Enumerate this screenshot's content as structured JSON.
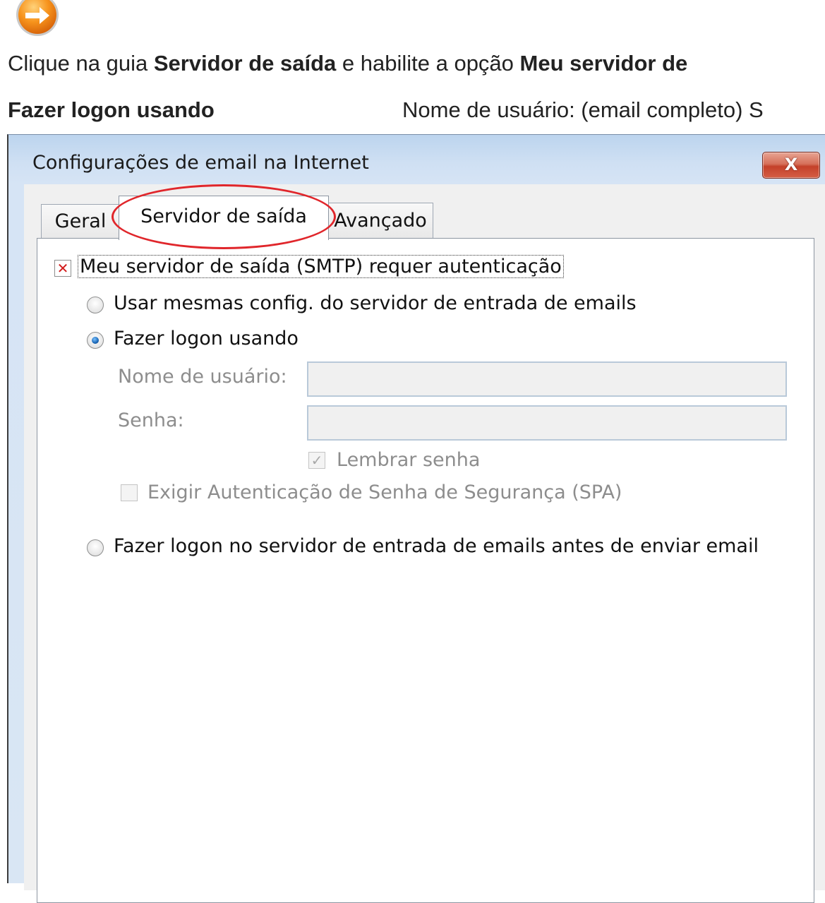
{
  "instructions": {
    "line1": [
      {
        "text": "Clique na guia ",
        "bold": false
      },
      {
        "text": "Servidor de saída",
        "bold": true
      },
      {
        "text": " e habilite a opção ",
        "bold": false
      },
      {
        "text": "Meu servidor de",
        "bold": true
      }
    ],
    "line2_left": "Fazer logon usando",
    "line2_right": "Nome de usuário: (email completo) S"
  },
  "dialog": {
    "title": "Configurações de email na Internet",
    "close_label": "X",
    "tabs": [
      "Geral",
      "Servidor de saída",
      "Avançado"
    ],
    "active_tab": "Servidor de saída",
    "smtp_auth_label": "Meu servidor de saída (SMTP) requer autenticação",
    "smtp_auth_checked": true,
    "option_same": "Usar mesmas config. do servidor de entrada de emails",
    "option_logon": "Fazer logon usando",
    "username_label": "Nome de usuário:",
    "username_value": "",
    "password_label": "Senha:",
    "password_value": "",
    "remember_label": "Lembrar senha",
    "remember_checked": true,
    "spa_label": "Exigir Autenticação de Senha de Segurança (SPA)",
    "spa_checked": false,
    "option_incoming": "Fazer logon no servidor de entrada de emails antes de enviar email",
    "selected_option": "Fazer logon usando",
    "highlight_color": "#e0262b"
  }
}
